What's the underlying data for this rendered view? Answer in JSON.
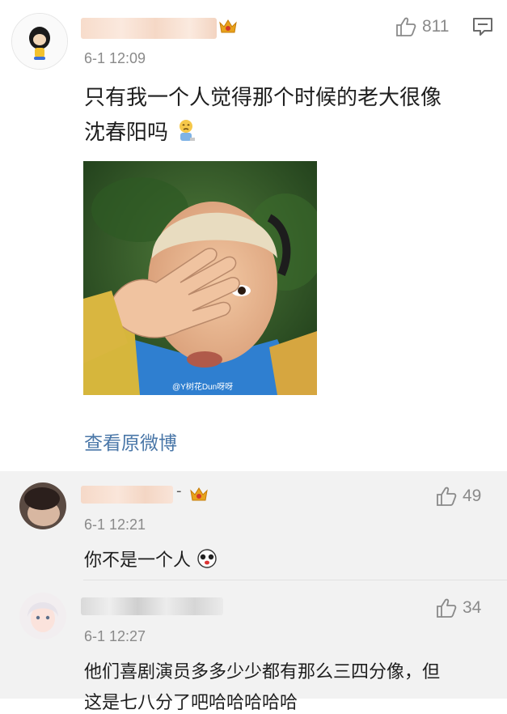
{
  "main_post": {
    "timestamp": "6-1 12:09",
    "like_count": "811",
    "text_line1": "只有我一个人觉得那个时候的老大很像",
    "text_line2": "沈春阳吗",
    "image_watermark": "@Y树花Dun呀呀",
    "view_original_label": "查看原微博",
    "icons": {
      "like": "thumbs-up-icon",
      "comment": "comment-icon",
      "crown": "vip-crown-icon",
      "emoji": "crying-emoji-icon"
    }
  },
  "replies": [
    {
      "timestamp": "6-1 12:21",
      "like_count": "49",
      "text": "你不是一个人",
      "name_suffix": "-"
    },
    {
      "timestamp": "6-1 12:27",
      "like_count": "34",
      "text_line1": "他们喜剧演员多多少少都有那么三四分像，但",
      "text_line2": "这是七八分了吧哈哈哈哈哈"
    }
  ],
  "colors": {
    "link": "#4a77a8",
    "meta": "#8a8a8a",
    "reply_bg": "#f2f2f2",
    "crown": "#e8a21c"
  }
}
